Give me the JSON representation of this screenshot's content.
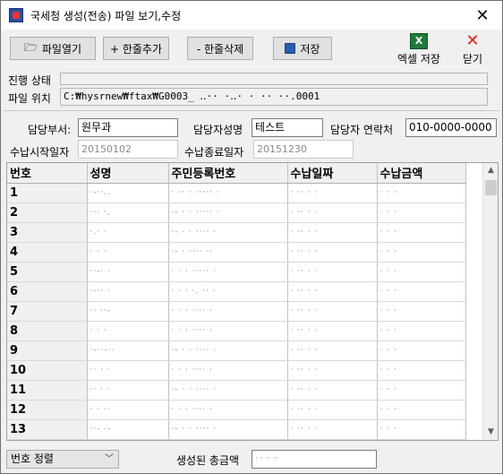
{
  "window": {
    "title": "국세청 생성(전송) 파일 보기,수정",
    "close_glyph": "✕"
  },
  "toolbar": {
    "open_file": "파일열기",
    "add_row": "+ 한줄추가",
    "delete_row": "- 한줄삭제",
    "save": "저장",
    "excel_save": "엑셀 저장",
    "close": "닫기"
  },
  "status": {
    "progress_label": "진행 상태",
    "path_label": "파일 위치",
    "path_value": "C:₩hysrnew₩ftax₩G0003_  ‥·· ·‥·  ·  ·· ··.0001"
  },
  "form": {
    "dept_label": "담당부서:",
    "dept_value": "원무과",
    "manager_label": "담당자성명",
    "manager_value": "테스트",
    "contact_label": "담당자 연락처",
    "contact_value": "010-0000-0000",
    "start_label": "수납시작일자",
    "start_value": "20150102",
    "end_label": "수납종료일자",
    "end_value": "20151230"
  },
  "table": {
    "columns": [
      "번호",
      "성명",
      "주민등록번호",
      "수납일짜",
      "수납금액"
    ],
    "rows": [
      {
        "no": "1",
        "name": "·-··..",
        "id": "·  ··  ·  ·····  ·",
        "date": "·  ··  ·  ·",
        "amount": "· ·  ·"
      },
      {
        "no": "2",
        "name": "··· ·,",
        "id": "·-  ·  ·  ·····  ·",
        "date": "·  ··  ·  ·",
        "amount": "· ·  ·"
      },
      {
        "no": "3",
        "name": "·.·  ·",
        "id": "·-  ·  ·  ····  ·",
        "date": "·  ··  ·  ·",
        "amount": "· ·  ·"
      },
      {
        "no": "4",
        "name": "·  ·  ·",
        "id": "·-  ·  ····  ··",
        "date": "·  ··  ·  ·",
        "amount": "· ·  ·"
      },
      {
        "no": "5",
        "name": "··-· ·",
        "id": "·  ·  ·  ·····  ·",
        "date": "·  ··  ·  ·",
        "amount": "· ·  ·"
      },
      {
        "no": "6",
        "name": "·-··  ·",
        "id": "·  ·  ·  ·.  ··  ·",
        "date": "·  ··  ·  ·",
        "amount": "· ·  ·"
      },
      {
        "no": "7",
        "name": "··  ··-",
        "id": "·  ·  ·  ····  ·",
        "date": "·  ··  ·  ·",
        "amount": "· ·  ·"
      },
      {
        "no": "8",
        "name": "·  ·  ·",
        "id": "·  ·  ·  ····  ·",
        "date": "·  ··  ·  ·",
        "amount": "· ·  ·"
      },
      {
        "no": "9",
        "name": "·-··-··",
        "id": "·-  ·  ·  ····  ·",
        "date": "·  ··  ·  ·",
        "amount": "· ·  ·"
      },
      {
        "no": "10",
        "name": "··  ·  ·",
        "id": "·  ·  ·  ····  ·",
        "date": "·  ··  ·  ·",
        "amount": "· ·  ·"
      },
      {
        "no": "11",
        "name": "··  ·  ·",
        "id": "·-  ·  ·  ····  ·",
        "date": "·  ··  ·  ·",
        "amount": "· ·  ·"
      },
      {
        "no": "12",
        "name": "·  ·  ··",
        "id": "·  ·  ·  ····  ·",
        "date": "·  ··  ·  ·",
        "amount": "· ·  ·"
      },
      {
        "no": "13",
        "name": "··-  ·-",
        "id": "·-  ·  ·  ····  ·",
        "date": "·  ··  ·  ·",
        "amount": "· ·  ·"
      }
    ]
  },
  "footer": {
    "sort_select": "번호 정렬",
    "total_label": "생성된 총금액",
    "total_value": "· ·  ··  ··"
  }
}
